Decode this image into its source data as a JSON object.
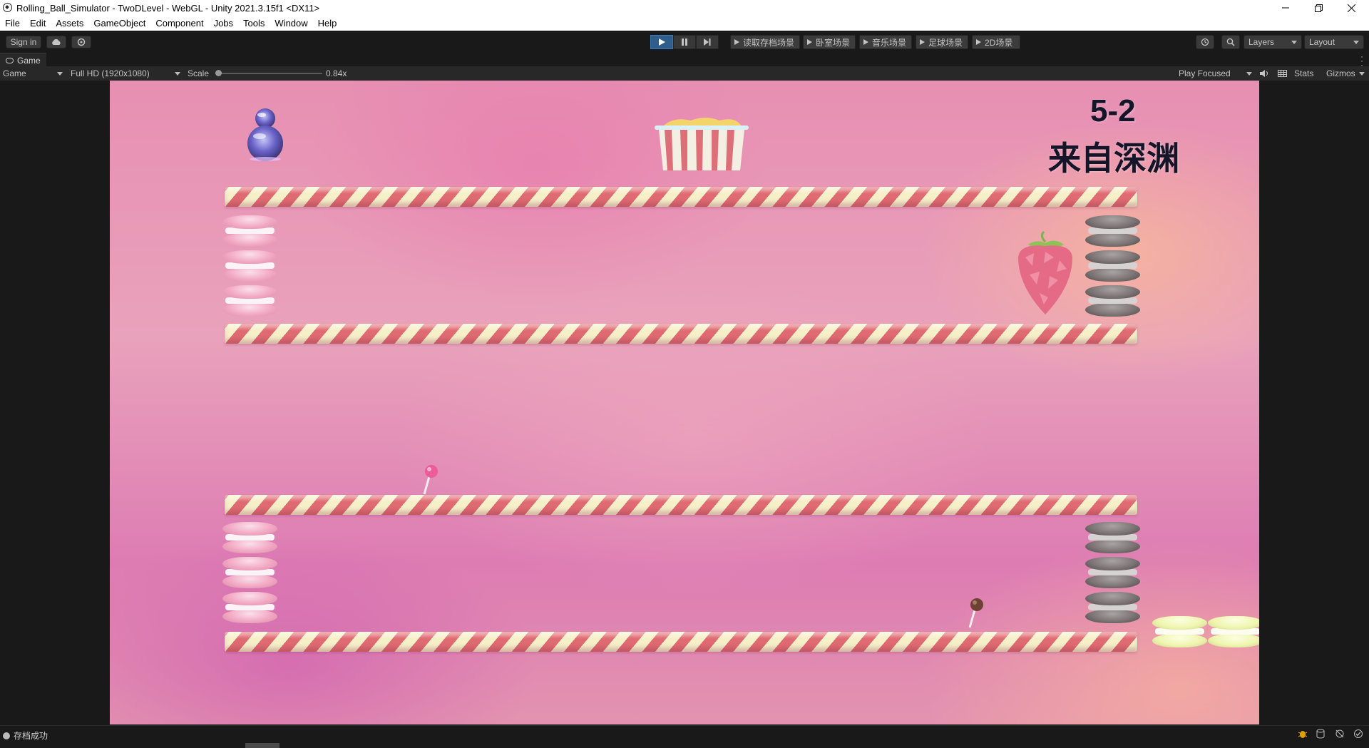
{
  "window": {
    "title": "Rolling_Ball_Simulator - TwoDLevel - WebGL - Unity 2021.3.15f1 <DX11>",
    "controls": [
      "minimize-icon",
      "restore-icon",
      "close-icon"
    ]
  },
  "menu": [
    "File",
    "Edit",
    "Assets",
    "GameObject",
    "Component",
    "Jobs",
    "Tools",
    "Window",
    "Help"
  ],
  "toolbar": {
    "sign_in": "Sign in",
    "cloud_icon": "cloud-icon",
    "collab_icon": "collab-icon",
    "play_state": "playing",
    "scene_buttons": [
      "读取存档场景",
      "卧室场景",
      "音乐场景",
      "足球场景",
      "2D场景"
    ],
    "history_icon": "history-icon",
    "search_icon": "search-icon",
    "layers": "Layers",
    "layout": "Layout"
  },
  "tab": {
    "label": "Game",
    "more_icon": "kebab-menu-icon"
  },
  "game_toolbar": {
    "display": "Game",
    "resolution": "Full HD (1920x1080)",
    "scale_label": "Scale",
    "scale_value": "0.84x",
    "scale_fraction": 0.0,
    "play_mode": "Play Focused",
    "audio_icon": "speaker-icon",
    "stats_icon": "grid-icon",
    "stats": "Stats",
    "gizmos": "Gizmos"
  },
  "game": {
    "level_number": "5-2",
    "level_name": "来自深渊"
  },
  "status": {
    "message": "存档成功",
    "icons": [
      "bug-icon",
      "cache-icon",
      "network-icon",
      "check-icon"
    ],
    "accent": "#e0a000"
  },
  "colors": {
    "play_active": "#2f5d8c",
    "pole_cream": "#f6f0c9",
    "pole_red": "#e06a72",
    "macaron_pink": "#f2a9c3",
    "macaron_gray": "#7d7575",
    "macaron_yellow": "#eff6b0"
  }
}
